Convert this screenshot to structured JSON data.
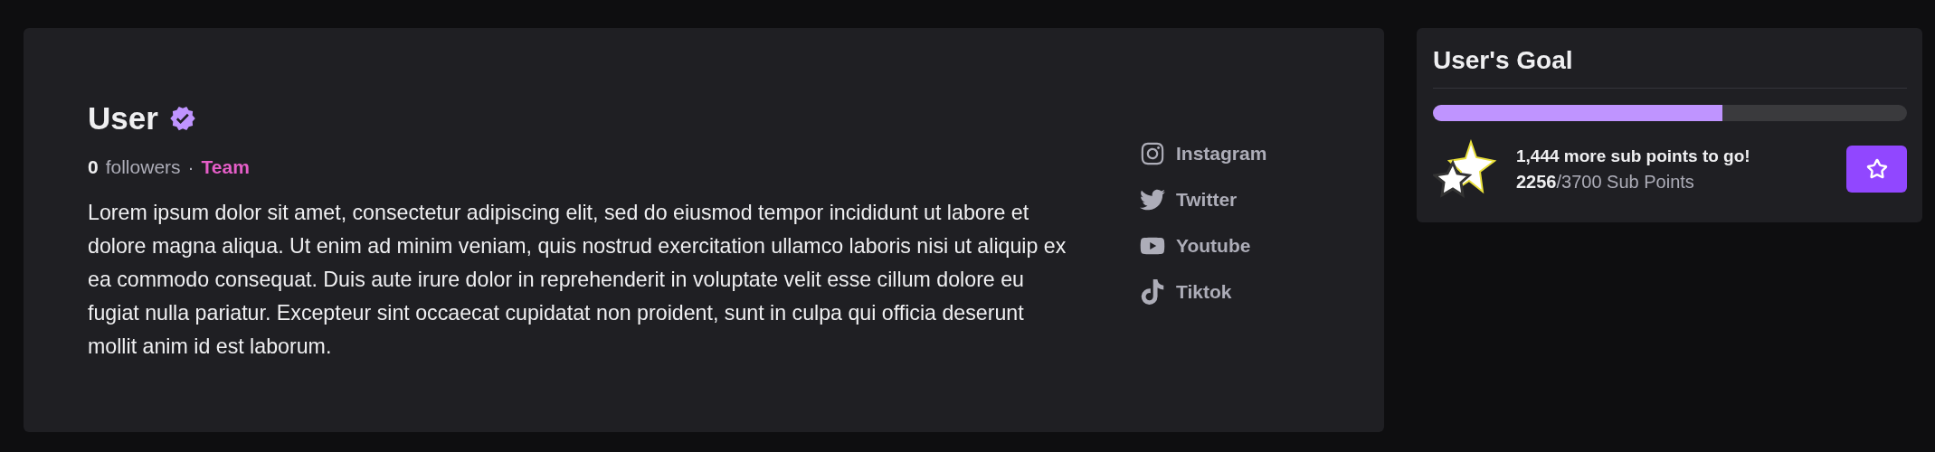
{
  "profile": {
    "name": "User",
    "verified": true,
    "followers_count": "0",
    "followers_label": "followers",
    "separator": "·",
    "team": "Team",
    "bio": "Lorem ipsum dolor sit amet, consectetur adipiscing elit, sed do eiusmod tempor incididunt ut labore et dolore magna aliqua. Ut enim ad minim veniam, quis nostrud exercitation ullamco laboris nisi ut aliquip ex ea commodo consequat. Duis aute irure dolor in reprehenderit in voluptate velit esse cillum dolore eu fugiat nulla pariatur. Excepteur sint occaecat cupidatat non proident, sunt in culpa qui officia deserunt mollit anim id est laborum."
  },
  "social_links": [
    {
      "kind": "instagram",
      "label": "Instagram"
    },
    {
      "kind": "twitter",
      "label": "Twitter"
    },
    {
      "kind": "youtube",
      "label": "Youtube"
    },
    {
      "kind": "tiktok",
      "label": "Tiktok"
    }
  ],
  "goal": {
    "title": "User's Goal",
    "level": 0.61,
    "remaining": "1,444 more sub points to go!",
    "progress": "**2256**/3700 Sub Points"
  }
}
